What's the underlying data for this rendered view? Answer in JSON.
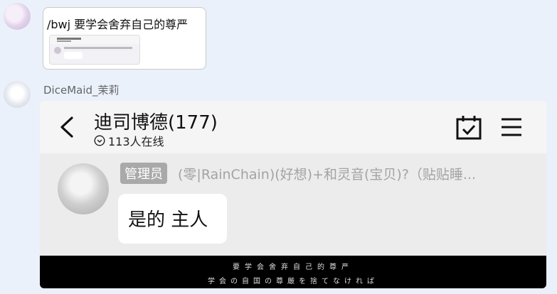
{
  "user_message": {
    "text": "/bwj 要学会舍弃自己的尊严"
  },
  "bot": {
    "sender_name": "DiceMaid_茉莉"
  },
  "screenshot": {
    "group_title": "迪司博德(177)",
    "online_count": "113人在线",
    "message": {
      "role_badge": "管理员",
      "nickname": "(零|RainChain)(好想)+和灵音(宝贝)?（贴贴睡...",
      "text": "是的 主人"
    },
    "caption_line1": "要学会舍弃自己的尊严",
    "caption_line2": "学会の自国の尊厳を捨てなければ"
  },
  "icons": {
    "back": "chevron-left-icon",
    "online": "chevron-down-circle-icon",
    "calendar": "calendar-check-icon",
    "menu": "hamburger-menu-icon"
  }
}
